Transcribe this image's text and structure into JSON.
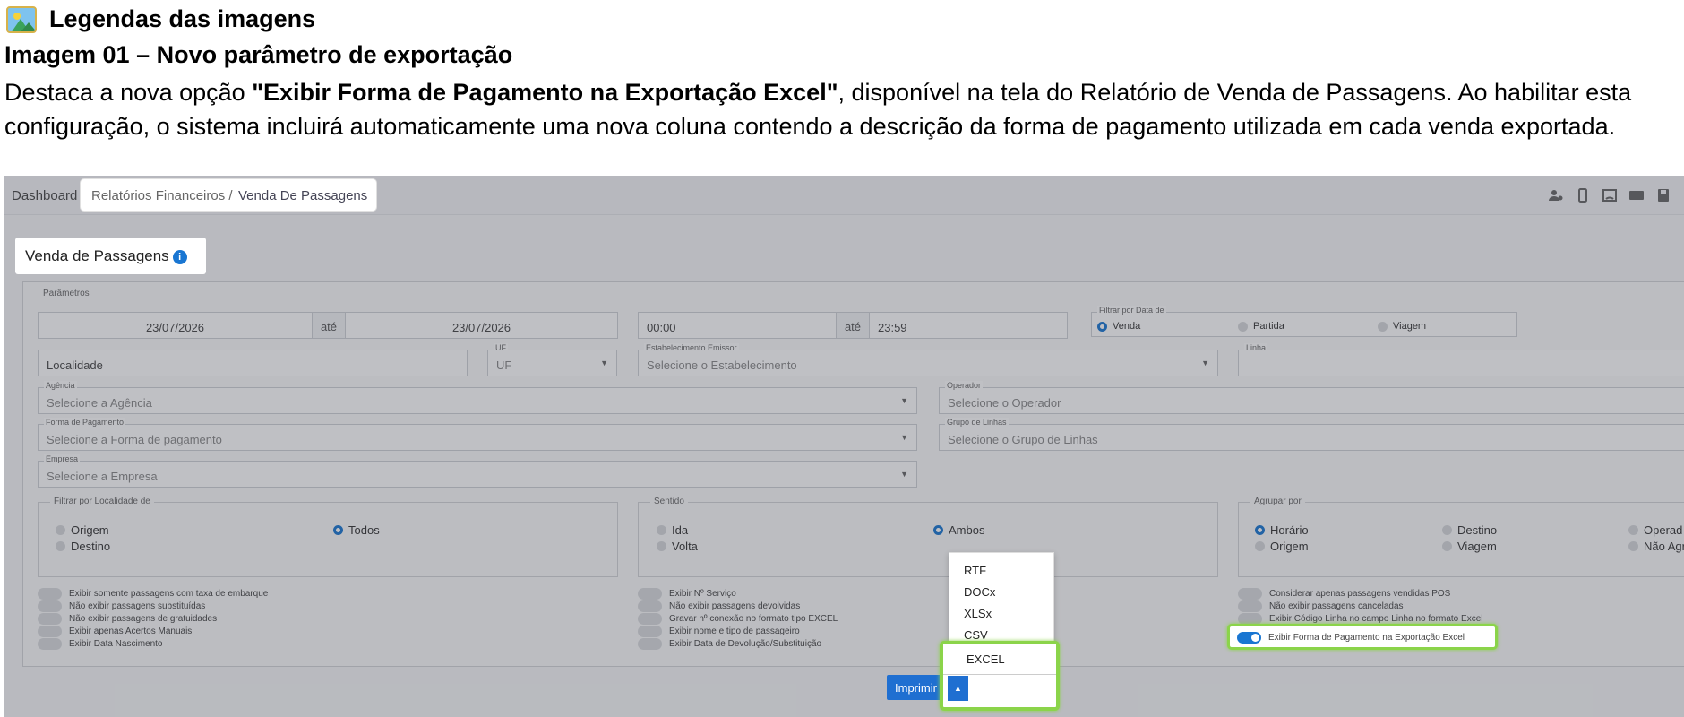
{
  "caption": {
    "heading": "Legendas das imagens",
    "subheading": "Imagem 01 – Novo parâmetro de exportação",
    "paragraph_start": "Destaca a nova opção ",
    "paragraph_bold": "\"Exibir Forma de Pagamento na Exportação Excel\"",
    "paragraph_end": ", disponível na tela do Relatório de Venda de Passagens. Ao habilitar esta configuração, o sistema incluirá automaticamente uma nova coluna contendo a descrição da forma de pagamento utilizada em cada venda exportada."
  },
  "breadcrumb": {
    "root": "Dashboard /",
    "level1": "Relatórios Financeiros /",
    "level2": "Venda De Passagens"
  },
  "page_title": "Venda de Passagens",
  "info_icon": "i",
  "params_legend": "Parâmetros",
  "date_range": {
    "start": "23/07/2026",
    "sep": "até",
    "end": "23/07/2026"
  },
  "time_range": {
    "start": "00:00",
    "sep": "até",
    "end": "23:59"
  },
  "filter_date": {
    "label": "Filtrar por Data de",
    "options": [
      "Venda",
      "Partida",
      "Viagem"
    ],
    "selected": "Venda"
  },
  "fields": {
    "localidade": "Localidade",
    "uf_label": "UF",
    "uf": "UF",
    "estab_label": "Estabelecimento Emissor",
    "estab": "Selecione o Estabelecimento",
    "linha_label": "Linha",
    "agencia_label": "Agência",
    "agencia": "Selecione a Agência",
    "operador_label": "Operador",
    "operador": "Selecione o Operador",
    "forma_label": "Forma de Pagamento",
    "forma": "Selecione a Forma de pagamento",
    "grupo_label": "Grupo de Linhas",
    "grupo": "Selecione o Grupo de Linhas",
    "empresa_label": "Empresa",
    "empresa": "Selecione a Empresa"
  },
  "filtro_localidade": {
    "label": "Filtrar por Localidade de",
    "origem": "Origem",
    "destino": "Destino",
    "todos": "Todos"
  },
  "sentido": {
    "label": "Sentido",
    "ida": "Ida",
    "volta": "Volta",
    "ambos": "Ambos"
  },
  "agrupar": {
    "label": "Agrupar por",
    "horario": "Horário",
    "origem": "Origem",
    "destino": "Destino",
    "viagem": "Viagem",
    "operador": "Operad",
    "nao": "Não Agr"
  },
  "toggles_col1": [
    "Exibir somente passagens com taxa de embarque",
    "Não exibir passagens substituídas",
    "Não exibir passagens de gratuidades",
    "Exibir apenas Acertos Manuais",
    "Exibir Data Nascimento"
  ],
  "toggles_col2": [
    "Exibir Nº Serviço",
    "Não exibir passagens devolvidas",
    "Gravar nº conexão no formato tipo EXCEL",
    "Exibir nome e tipo de passageiro",
    "Exibir Data de Devolução/Substituição"
  ],
  "toggles_col3": [
    "Considerar apenas passagens vendidas POS",
    "Não exibir passagens canceladas",
    "Exibir Código Linha no campo Linha no formato Excel",
    "Exibir Forma de Pagamento na Exportação Excel"
  ],
  "export_menu": [
    "RTF",
    "DOCx",
    "XLSx",
    "CSV",
    "EXCEL"
  ],
  "print_button": "Imprimir"
}
